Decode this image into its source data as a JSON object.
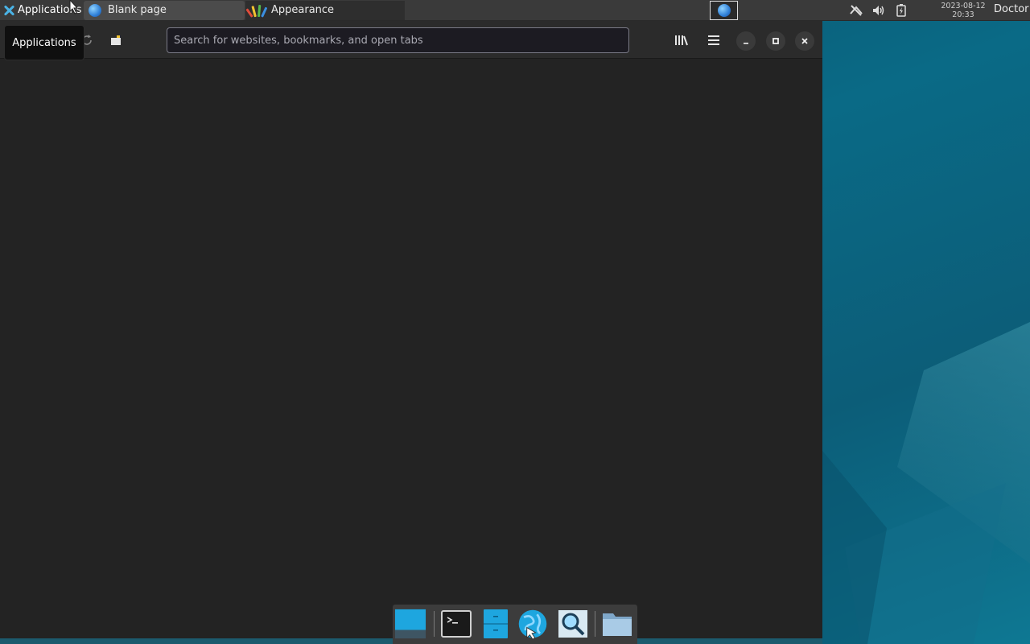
{
  "panel": {
    "app_menu_label": "Applications",
    "tasks": [
      {
        "label": "Blank page",
        "icon": "firefox-globe-icon"
      },
      {
        "label": "Appearance",
        "icon": "appearance-icon"
      }
    ],
    "clock_date": "2023-08-12",
    "clock_time": "20:33",
    "user": "Doctor"
  },
  "browser": {
    "search_placeholder": "Search for websites, bookmarks, and open tabs",
    "tooltip": "Applications"
  },
  "dock": {
    "items": [
      "show-desktop",
      "terminal",
      "file-manager",
      "web-browser",
      "app-finder",
      "home-folder"
    ]
  },
  "colors": {
    "panel_bg": "#3a3a3a",
    "browser_bg": "#232323",
    "accent": "#1e9fd8",
    "desktop_teal": "#0a6a86"
  }
}
